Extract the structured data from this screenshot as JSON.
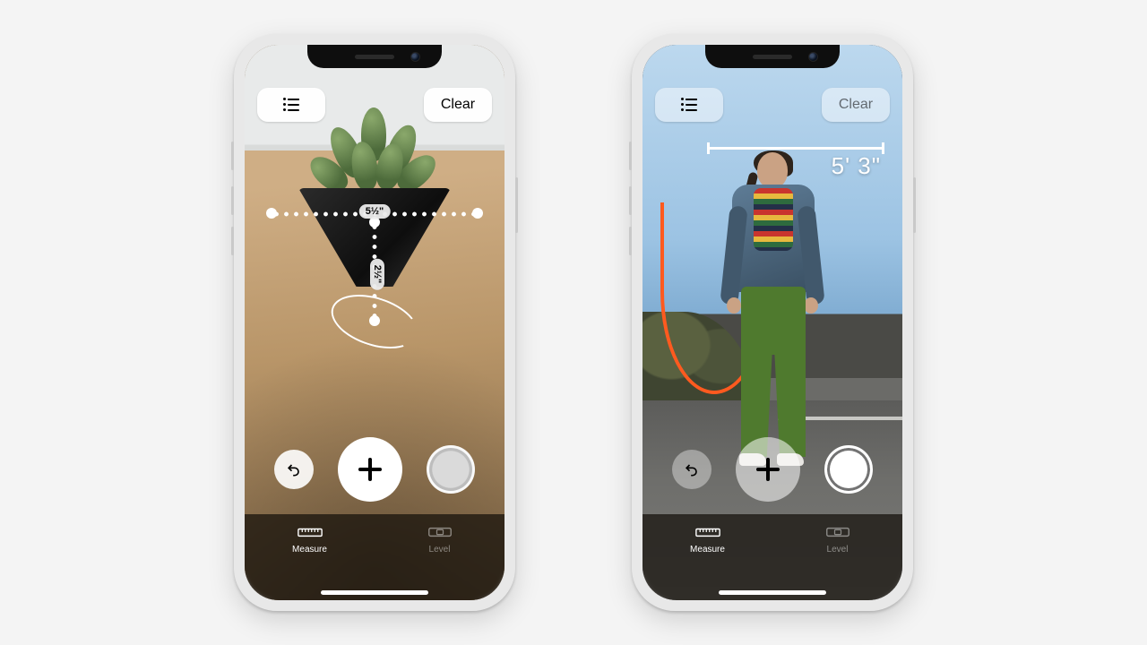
{
  "left_phone": {
    "top": {
      "list_icon": "list-icon",
      "clear_label": "Clear"
    },
    "measurements": {
      "width": "5½\"",
      "height": "2½\""
    },
    "actions": {
      "undo_icon": "undo-icon",
      "add_icon": "plus-icon",
      "shutter_icon": "shutter-icon"
    },
    "tabs": {
      "measure": "Measure",
      "level": "Level",
      "active": "measure"
    }
  },
  "right_phone": {
    "top": {
      "list_icon": "list-icon",
      "clear_label": "Clear"
    },
    "measurement": {
      "person_height": "5' 3\""
    },
    "actions": {
      "undo_icon": "undo-icon",
      "add_icon": "plus-icon",
      "shutter_icon": "shutter-icon"
    },
    "tabs": {
      "measure": "Measure",
      "level": "Level",
      "active": "measure"
    }
  }
}
